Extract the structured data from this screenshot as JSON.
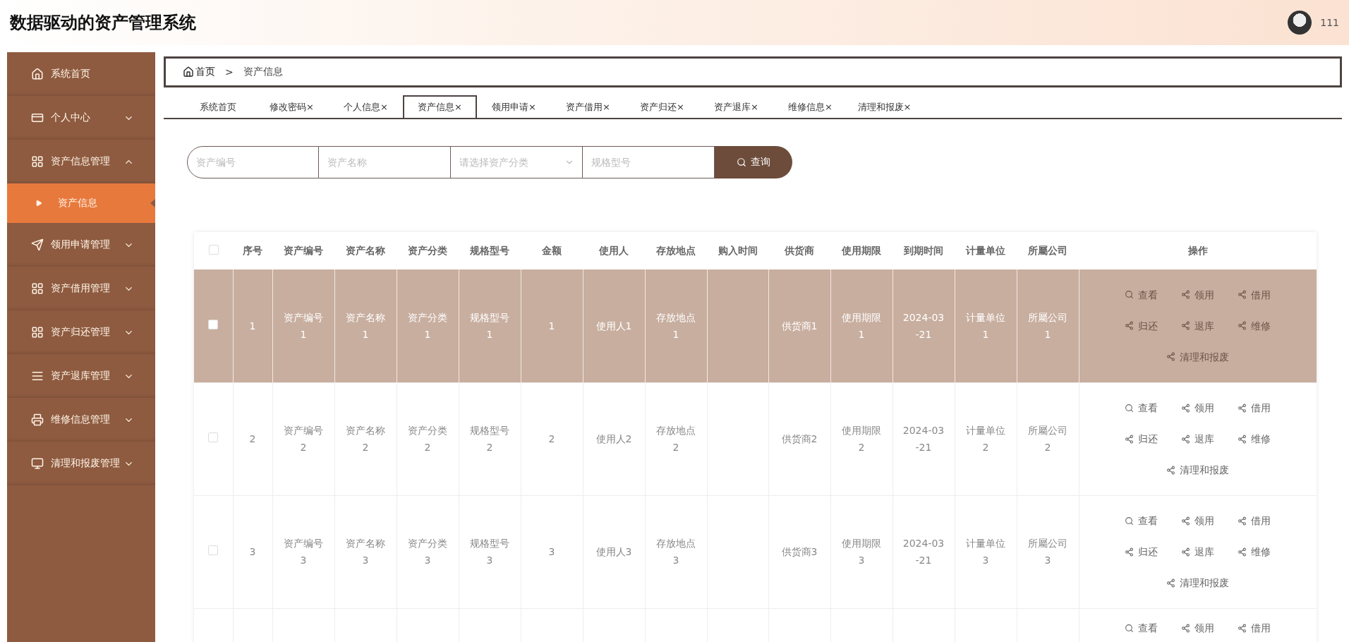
{
  "header": {
    "title": "数据驱动的资产管理系统",
    "user": {
      "name": "111"
    }
  },
  "sidebar": {
    "items": [
      {
        "label": "系统首页"
      },
      {
        "label": "个人中心",
        "expanded": false
      },
      {
        "label": "资产信息管理",
        "expanded": true,
        "children": [
          {
            "label": "资产信息",
            "selected": true
          }
        ]
      },
      {
        "label": "领用申请管理",
        "expanded": false
      },
      {
        "label": "资产借用管理",
        "expanded": false
      },
      {
        "label": "资产归还管理",
        "expanded": false
      },
      {
        "label": "资产退库管理",
        "expanded": false
      },
      {
        "label": "维修信息管理",
        "expanded": false
      },
      {
        "label": "清理和报废管理",
        "expanded": false
      }
    ]
  },
  "breadcrumb": {
    "home": "首页",
    "separator": ">",
    "current": "资产信息"
  },
  "tabs": [
    {
      "label": "系统首页",
      "selected": false
    },
    {
      "label": "修改密码×",
      "selected": false
    },
    {
      "label": "个人信息×",
      "selected": false
    },
    {
      "label": "资产信息×",
      "selected": true
    },
    {
      "label": "领用申请×",
      "selected": false
    },
    {
      "label": "资产借用×",
      "selected": false
    },
    {
      "label": "资产归还×",
      "selected": false
    },
    {
      "label": "资产退库×",
      "selected": false
    },
    {
      "label": "维修信息×",
      "selected": false
    },
    {
      "label": "清理和报废×",
      "selected": false
    }
  ],
  "search": {
    "fields": [
      {
        "kind": "input",
        "placeholder": "资产编号"
      },
      {
        "kind": "input",
        "placeholder": "资产名称"
      },
      {
        "kind": "select",
        "placeholder": "请选择资产分类"
      },
      {
        "kind": "input",
        "placeholder": "规格型号"
      }
    ],
    "button": "查询"
  },
  "table": {
    "select_all": {
      "checked": false
    },
    "columns": [
      "序号",
      "资产编号",
      "资产名称",
      "资产分类",
      "规格型号",
      "金额",
      "使用人",
      "存放地点",
      "购入时间",
      "供货商",
      "使用期限",
      "到期时间",
      "计量单位",
      "所屬公司",
      "操作"
    ],
    "rows": [
      {
        "highlighted": true,
        "checked": false,
        "cells": [
          "1",
          "资产编号\n1",
          "资产名称\n1",
          "资产分类\n1",
          "规格型号\n1",
          "1",
          "使用人1",
          "存放地点\n1",
          "",
          "供货商1",
          "使用期限\n1",
          "2024-03\n-21",
          "计量单位\n1",
          "所屬公司\n1"
        ],
        "actions": [
          {
            "kind": "view",
            "label": "查看"
          },
          {
            "kind": "share",
            "label": "领用"
          },
          {
            "kind": "share",
            "label": "借用"
          },
          {
            "kind": "share",
            "label": "归还"
          },
          {
            "kind": "share",
            "label": "退库"
          },
          {
            "kind": "share",
            "label": "维修"
          },
          {
            "kind": "share",
            "label": "清理和报废"
          }
        ]
      },
      {
        "highlighted": false,
        "checked": false,
        "cells": [
          "2",
          "资产编号\n2",
          "资产名称\n2",
          "资产分类\n2",
          "规格型号\n2",
          "2",
          "使用人2",
          "存放地点\n2",
          "",
          "供货商2",
          "使用期限\n2",
          "2024-03\n-21",
          "计量单位\n2",
          "所屬公司\n2"
        ],
        "actions": [
          {
            "kind": "view",
            "label": "查看"
          },
          {
            "kind": "share",
            "label": "领用"
          },
          {
            "kind": "share",
            "label": "借用"
          },
          {
            "kind": "share",
            "label": "归还"
          },
          {
            "kind": "share",
            "label": "退库"
          },
          {
            "kind": "share",
            "label": "维修"
          },
          {
            "kind": "share",
            "label": "清理和报废"
          }
        ]
      },
      {
        "highlighted": false,
        "checked": false,
        "cells": [
          "3",
          "资产编号\n3",
          "资产名称\n3",
          "资产分类\n3",
          "规格型号\n3",
          "3",
          "使用人3",
          "存放地点\n3",
          "",
          "供货商3",
          "使用期限\n3",
          "2024-03\n-21",
          "计量单位\n3",
          "所屬公司\n3"
        ],
        "actions": [
          {
            "kind": "view",
            "label": "查看"
          },
          {
            "kind": "share",
            "label": "领用"
          },
          {
            "kind": "share",
            "label": "借用"
          },
          {
            "kind": "share",
            "label": "归还"
          },
          {
            "kind": "share",
            "label": "退库"
          },
          {
            "kind": "share",
            "label": "维修"
          },
          {
            "kind": "share",
            "label": "清理和报废"
          }
        ]
      }
    ],
    "partial_row": {
      "actions": [
        {
          "kind": "view",
          "label": "查看"
        },
        {
          "kind": "share",
          "label": "领用"
        },
        {
          "kind": "share",
          "label": "借用"
        }
      ]
    }
  }
}
